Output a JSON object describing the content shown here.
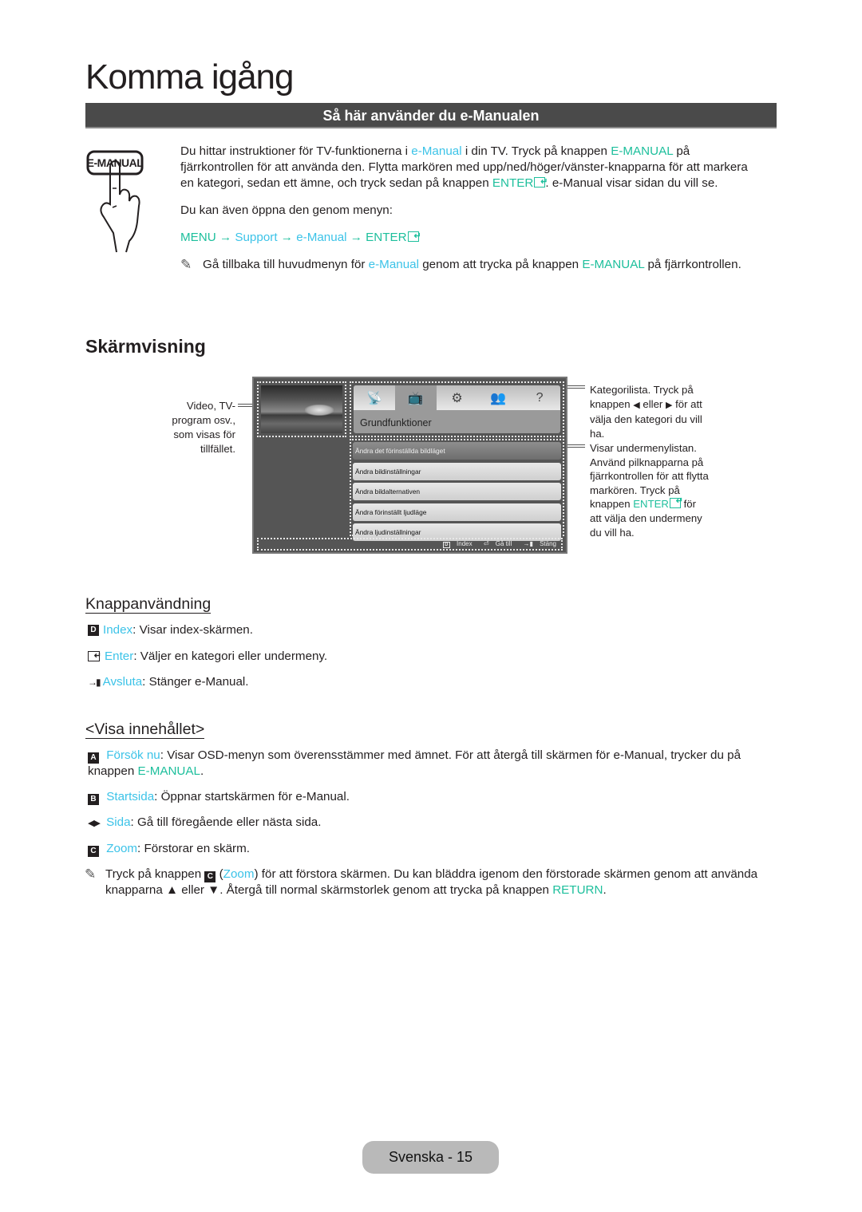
{
  "page": {
    "title": "Komma igång",
    "section_bar": "Så här använder du e-Manualen",
    "footer": "Svenska - 15"
  },
  "colors": {
    "link_cyan": "#3cc3e8",
    "link_teal": "#1dbf9c",
    "bar": "#4a4a4a"
  },
  "emanual_button_label": "E-MANUAL",
  "intro": {
    "p1": [
      {
        "t": "Du hittar instruktioner för TV-funktionerna i ",
        "c": ""
      },
      {
        "t": "e-Manual",
        "c": "cyan"
      },
      {
        "t": " i din TV. Tryck på knappen ",
        "c": ""
      },
      {
        "t": "E-MANUAL",
        "c": "teal"
      },
      {
        "t": " på fjärrkontrollen för att använda den. Flytta markören med upp/ned/höger/vänster-knapparna för att markera en kategori, sedan ett ämne, och tryck sedan på knappen ",
        "c": ""
      },
      {
        "t": "ENTER",
        "c": "teal",
        "enter": true
      },
      {
        "t": ". e-Manual visar sidan du vill se.",
        "c": ""
      }
    ],
    "p2": "Du kan även öppna den genom menyn:",
    "menu_path": [
      {
        "t": "MENU",
        "c": "teal"
      },
      {
        "t": " → ",
        "c": "teal"
      },
      {
        "t": "Support",
        "c": "cyan"
      },
      {
        "t": " → ",
        "c": "teal"
      },
      {
        "t": "e-Manual",
        "c": "cyan"
      },
      {
        "t": " → ",
        "c": "teal"
      },
      {
        "t": "ENTER",
        "c": "teal",
        "enter": true
      }
    ],
    "note": [
      {
        "t": "Gå tillbaka till huvudmenyn för ",
        "c": ""
      },
      {
        "t": "e-Manual",
        "c": "cyan"
      },
      {
        "t": " genom att trycka på knappen ",
        "c": ""
      },
      {
        "t": "E-MANUAL",
        "c": "teal"
      },
      {
        "t": " på fjärrkontrollen.",
        "c": ""
      }
    ]
  },
  "screen": {
    "heading": "Skärmvisning",
    "callout_video": "Video, TV-program osv., som visas för tillfället.",
    "callout_category": [
      {
        "t": "Kategorilista. Tryck på knappen ",
        "c": ""
      },
      {
        "t": "◀",
        "c": "tri"
      },
      {
        "t": " eller ",
        "c": ""
      },
      {
        "t": "▶",
        "c": "tri"
      },
      {
        "t": " för att välja den kategori du vill ha.",
        "c": ""
      }
    ],
    "callout_submenu": [
      {
        "t": "Visar undermenylistan. Använd pilknapparna på fjärrkontrollen för att flytta markören. Tryck på knappen ",
        "c": ""
      },
      {
        "t": "ENTER",
        "c": "teal",
        "enter": true
      },
      {
        "t": " för att välja den undermeny du vill ha.",
        "c": ""
      }
    ],
    "tv": {
      "category_icons": [
        "satellite-dish-icon",
        "tv-icon",
        "tools-gear-icon",
        "people-icon",
        "help-icon"
      ],
      "active_category": 1,
      "category_label": "Grundfunktioner",
      "submenu": [
        "Ändra det förinställda bildläget",
        "Ändra bildinställningar",
        "Ändra bildalternativen",
        "Ändra förinställt ljudläge",
        "Ändra ljudinställningar"
      ],
      "selected_submenu": 0,
      "footer": {
        "index": "Index",
        "goto": "Gå till",
        "close": "Stäng",
        "index_key": "D"
      }
    }
  },
  "buttons": {
    "heading": "Knappanvändning",
    "items": [
      {
        "key": "D",
        "name": "Index",
        "desc": ": Visar index-skärmen."
      },
      {
        "key": "enter",
        "name": "Enter",
        "desc": ": Väljer en kategori eller undermeny."
      },
      {
        "key": "exit",
        "name": "Avsluta",
        "desc": ": Stänger e-Manual."
      }
    ]
  },
  "content": {
    "heading": "<Visa innehållet>",
    "items": [
      {
        "key": "A",
        "name": "Försök nu",
        "desc": ": Visar OSD-menyn som överensstämmer med ämnet. För att återgå till skärmen för e-Manual, trycker du på knappen ",
        "tail_link": "E-MANUAL",
        "tail": "."
      },
      {
        "key": "B",
        "name": "Startsida",
        "desc": ": Öppnar startskärmen för e-Manual."
      },
      {
        "key": "arrows",
        "name": "Sida",
        "desc": ": Gå till föregående eller nästa sida."
      },
      {
        "key": "C",
        "name": "Zoom",
        "desc": ": Förstorar en skärm."
      }
    ],
    "note": [
      {
        "t": "Tryck på knappen ",
        "c": ""
      },
      {
        "t": "C",
        "c": "key"
      },
      {
        "t": " (",
        "c": ""
      },
      {
        "t": "Zoom",
        "c": "cyan"
      },
      {
        "t": ") för att förstora skärmen. Du kan bläddra igenom den förstorade skärmen genom att använda knapparna ▲ eller ▼. Återgå till normal skärmstorlek genom att trycka på knappen ",
        "c": ""
      },
      {
        "t": "RETURN",
        "c": "teal"
      },
      {
        "t": ".",
        "c": ""
      }
    ]
  }
}
